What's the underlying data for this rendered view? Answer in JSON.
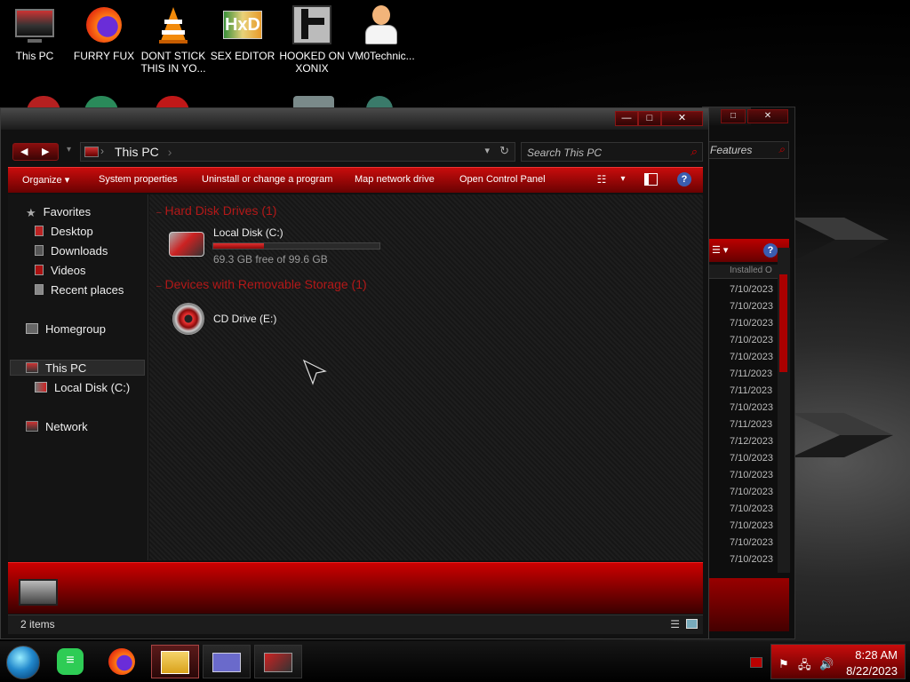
{
  "desktop_icons": [
    {
      "label": "This PC",
      "icon": "monitor-icon"
    },
    {
      "label": "FURRY FUX",
      "icon": "firefox-icon"
    },
    {
      "label": "DONT STICK THIS IN YO...",
      "icon": "vlc-cone-icon"
    },
    {
      "label": "SEX EDITOR",
      "icon": "hxd-editor-icon"
    },
    {
      "label": "HOOKED ON XONIX",
      "icon": "xonix-game-icon"
    },
    {
      "label": "VM0Technic...",
      "icon": "technician-person-icon"
    }
  ],
  "back_window": {
    "search_text": "Features",
    "column_header": "Installed O",
    "dates": [
      "7/10/2023",
      "7/10/2023",
      "7/10/2023",
      "7/10/2023",
      "7/10/2023",
      "7/11/2023",
      "7/11/2023",
      "7/10/2023",
      "7/11/2023",
      "7/12/2023",
      "7/10/2023",
      "7/10/2023",
      "7/10/2023",
      "7/10/2023",
      "7/10/2023",
      "7/10/2023",
      "7/10/2023"
    ]
  },
  "window": {
    "minimize": "—",
    "maximize": "□",
    "close": "✕",
    "address": "This PC",
    "search_placeholder": "Search This PC"
  },
  "commands": {
    "organize": "Organize",
    "system_properties": "System properties",
    "uninstall": "Uninstall or change a program",
    "map_drive": "Map network drive",
    "control_panel": "Open Control Panel",
    "help": "?"
  },
  "nav": {
    "favorites": "Favorites",
    "desktop": "Desktop",
    "downloads": "Downloads",
    "videos": "Videos",
    "recent": "Recent places",
    "homegroup": "Homegroup",
    "this_pc": "This PC",
    "local_disk": "Local Disk (C:)",
    "network": "Network"
  },
  "content": {
    "hdd_group": "Hard Disk Drives (1)",
    "local_disk_name": "Local Disk (C:)",
    "local_disk_free": "69.3 GB free of 99.6 GB",
    "used_fraction": 0.304,
    "removable_group": "Devices with Removable Storage (1)",
    "cd_name": "CD Drive (E:)"
  },
  "status": {
    "items": "2 items"
  },
  "taskbar": {
    "apps": [
      "start-orb-icon",
      "notes-app-icon",
      "firefox-icon",
      "file-explorer-icon",
      "control-panel-icon",
      "graphics-card-icon"
    ],
    "time": "8:28 AM",
    "date": "8/22/2023"
  },
  "colors": {
    "accent": "#c00a0a",
    "group_header": "#b31818",
    "background": "#000000"
  }
}
